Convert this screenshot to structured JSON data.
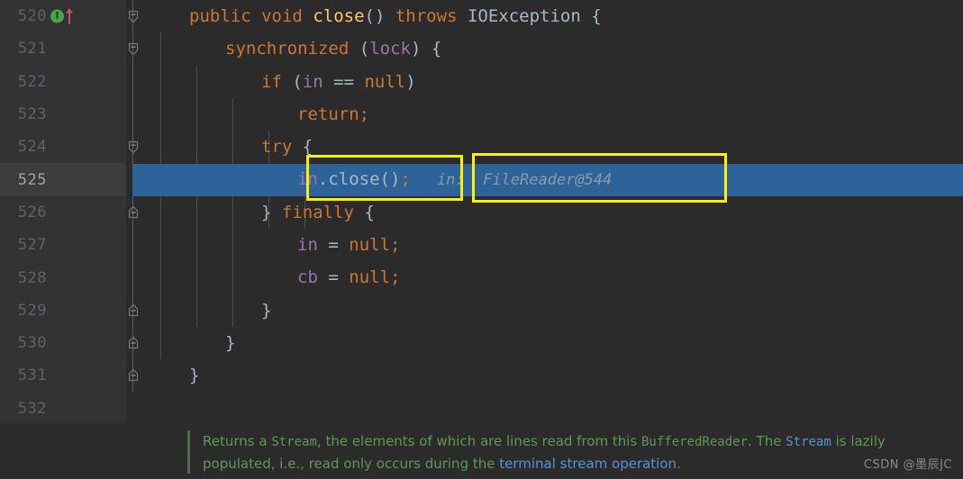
{
  "editor": {
    "theme_colors": {
      "background": "#2b2b2b",
      "gutter_background": "#313335",
      "current_line_gutter": "#3a3c3e",
      "selection_blue": "#2e6399",
      "keyword_orange": "#cc7832",
      "method_yellow": "#ffc66d",
      "field_purple": "#9876aa",
      "text_gray": "#a9b7c6",
      "lineno_gray": "#606366",
      "lineno_current": "#a4a3a0",
      "annotation_yellow": "#ffef00",
      "doc_green": "#629755",
      "doc_link_blue": "#5a93d4",
      "run_marker_green": "#49a54b",
      "arrow_red": "#c75450"
    },
    "lines": [
      {
        "number": "520",
        "fold": "open",
        "run_marker": "I",
        "has_up_arrow": true,
        "indent": 1,
        "tokens": [
          {
            "t": "public",
            "c": "kw"
          },
          {
            "t": " ",
            "c": "plain"
          },
          {
            "t": "void",
            "c": "kw"
          },
          {
            "t": " ",
            "c": "plain"
          },
          {
            "t": "close",
            "c": "method"
          },
          {
            "t": "()",
            "c": "punc"
          },
          {
            "t": " ",
            "c": "plain"
          },
          {
            "t": "throws",
            "c": "kw"
          },
          {
            "t": " ",
            "c": "plain"
          },
          {
            "t": "IOException",
            "c": "type"
          },
          {
            "t": " ",
            "c": "plain"
          },
          {
            "t": "{",
            "c": "brace"
          }
        ]
      },
      {
        "number": "521",
        "fold": "open",
        "indent": 2,
        "tokens": [
          {
            "t": "synchronized",
            "c": "kw"
          },
          {
            "t": " ",
            "c": "plain"
          },
          {
            "t": "(",
            "c": "punc"
          },
          {
            "t": "lock",
            "c": "field"
          },
          {
            "t": ")",
            "c": "punc"
          },
          {
            "t": " ",
            "c": "plain"
          },
          {
            "t": "{",
            "c": "brace"
          }
        ]
      },
      {
        "number": "522",
        "fold": "none",
        "indent": 3,
        "tokens": [
          {
            "t": "if",
            "c": "kw"
          },
          {
            "t": " ",
            "c": "plain"
          },
          {
            "t": "(",
            "c": "punc"
          },
          {
            "t": "in",
            "c": "field"
          },
          {
            "t": " ",
            "c": "plain"
          },
          {
            "t": "==",
            "c": "plain"
          },
          {
            "t": " ",
            "c": "plain"
          },
          {
            "t": "null",
            "c": "kw"
          },
          {
            "t": ")",
            "c": "punc"
          }
        ]
      },
      {
        "number": "523",
        "fold": "none",
        "indent": 4,
        "tokens": [
          {
            "t": "return",
            "c": "kw"
          },
          {
            "t": ";",
            "c": "semi"
          }
        ]
      },
      {
        "number": "524",
        "fold": "open",
        "indent": 3,
        "tokens": [
          {
            "t": "try",
            "c": "kw"
          },
          {
            "t": " ",
            "c": "plain"
          },
          {
            "t": "{",
            "c": "brace"
          }
        ]
      },
      {
        "number": "525",
        "fold": "none",
        "selected": true,
        "indent": 4,
        "tokens": [
          {
            "t": "in",
            "c": "field"
          },
          {
            "t": ".",
            "c": "punc"
          },
          {
            "t": "close",
            "c": "plain"
          },
          {
            "t": "()",
            "c": "punc"
          },
          {
            "t": ";",
            "c": "semi"
          }
        ],
        "inlay_hint": "in:  FileReader@544"
      },
      {
        "number": "526",
        "fold": "close",
        "indent": 3,
        "tokens": [
          {
            "t": "}",
            "c": "brace"
          },
          {
            "t": " ",
            "c": "plain"
          },
          {
            "t": "finally",
            "c": "kw"
          },
          {
            "t": " ",
            "c": "plain"
          },
          {
            "t": "{",
            "c": "brace"
          }
        ]
      },
      {
        "number": "527",
        "fold": "none",
        "indent": 4,
        "tokens": [
          {
            "t": "in",
            "c": "field"
          },
          {
            "t": " ",
            "c": "plain"
          },
          {
            "t": "=",
            "c": "plain"
          },
          {
            "t": " ",
            "c": "plain"
          },
          {
            "t": "null",
            "c": "kw"
          },
          {
            "t": ";",
            "c": "semi"
          }
        ]
      },
      {
        "number": "528",
        "fold": "none",
        "indent": 4,
        "tokens": [
          {
            "t": "cb",
            "c": "field"
          },
          {
            "t": " ",
            "c": "plain"
          },
          {
            "t": "=",
            "c": "plain"
          },
          {
            "t": " ",
            "c": "plain"
          },
          {
            "t": "null",
            "c": "kw"
          },
          {
            "t": ";",
            "c": "semi"
          }
        ]
      },
      {
        "number": "529",
        "fold": "close",
        "indent": 3,
        "tokens": [
          {
            "t": "}",
            "c": "brace"
          }
        ]
      },
      {
        "number": "530",
        "fold": "close",
        "indent": 2,
        "tokens": [
          {
            "t": "}",
            "c": "brace"
          }
        ]
      },
      {
        "number": "531",
        "fold": "close",
        "indent": 1,
        "tokens": [
          {
            "t": "}",
            "c": "brace"
          }
        ]
      },
      {
        "number": "532",
        "fold": "none",
        "indent": 0,
        "tokens": []
      }
    ]
  },
  "annotations": {
    "box_code": {
      "label": "in.close();"
    },
    "box_hint": {
      "label": "in:  FileReader@544"
    }
  },
  "doc_panel": {
    "segments": [
      {
        "text": "Returns a ",
        "style": "text"
      },
      {
        "text": "Stream",
        "style": "mono"
      },
      {
        "text": ", the elements of which are lines read from this ",
        "style": "text"
      },
      {
        "text": "BufferedReader",
        "style": "mono"
      },
      {
        "text": ". The ",
        "style": "text"
      },
      {
        "text": "Stream",
        "style": "link-mono"
      },
      {
        "text": " is lazily populated, i.e., read only occurs during the ",
        "style": "text"
      },
      {
        "text": "terminal stream operation",
        "style": "link"
      },
      {
        "text": ".",
        "style": "text"
      }
    ],
    "watermark": "CSDN @墨辰JC"
  }
}
